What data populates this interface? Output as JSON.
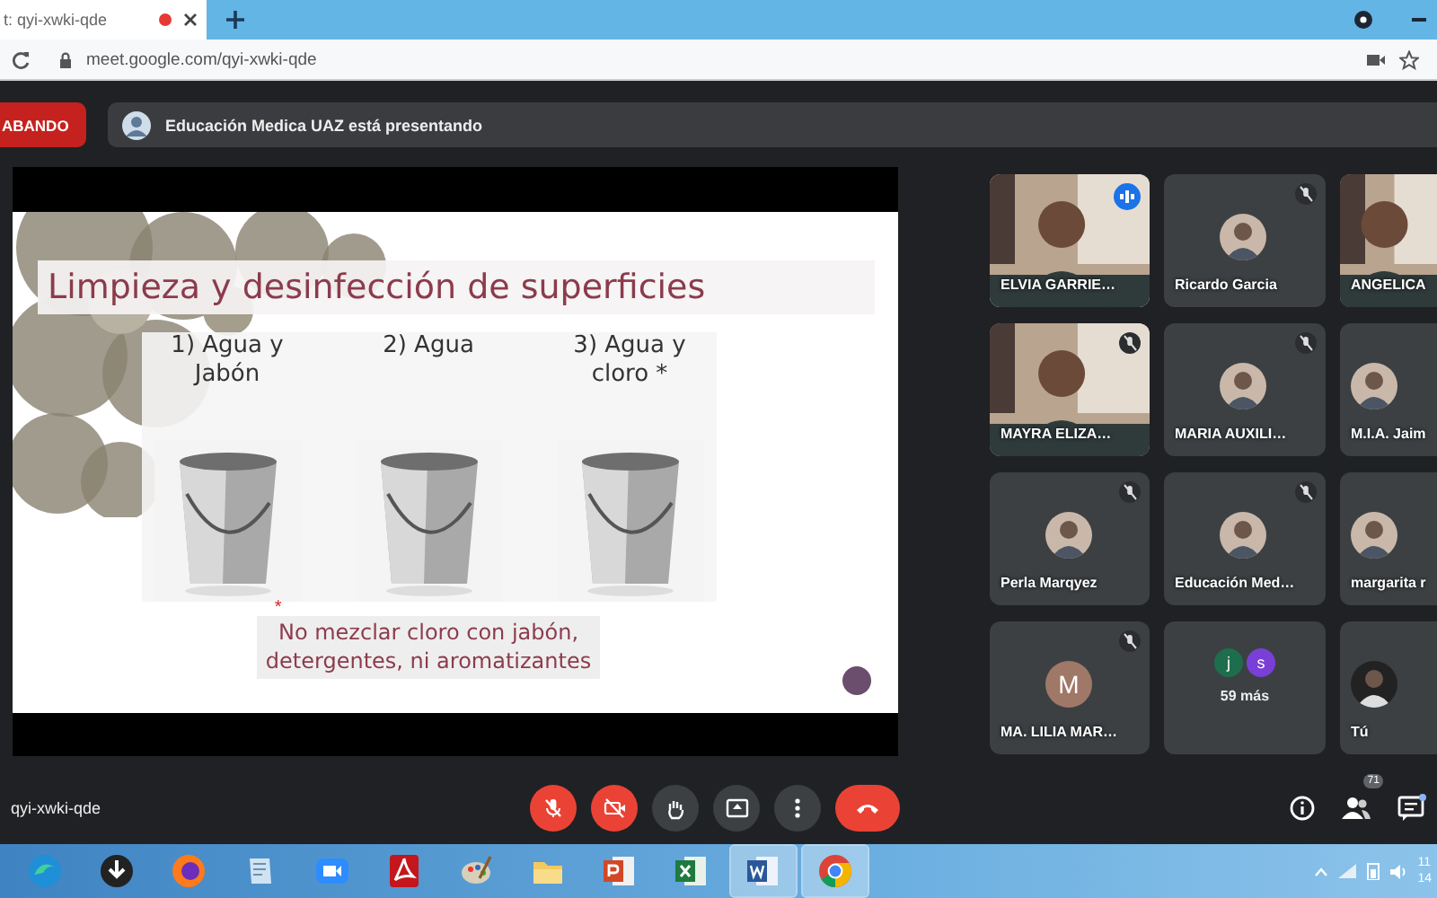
{
  "browser": {
    "tab_title": "t: qyi-xwki-qde",
    "url": "meet.google.com/qyi-xwki-qde"
  },
  "recording": {
    "label": "ABANDO"
  },
  "presenter_banner": {
    "text": "Educación Medica UAZ está presentando"
  },
  "slide": {
    "title": "Limpieza y desinfección de superficies",
    "options": [
      {
        "label": "1) Agua y\nJabón"
      },
      {
        "label": "2) Agua"
      },
      {
        "label": "3) Agua y\ncloro *"
      }
    ],
    "footnote_mark": "*",
    "note": "No mezclar cloro con jabón,\ndetergentes, ni aromatizantes"
  },
  "participants": [
    {
      "kind": "video",
      "name": "ELVIA GARRIE…",
      "muted": false,
      "speaking": true
    },
    {
      "kind": "avatar",
      "name": "Ricardo Garcia",
      "muted": true,
      "speaking": false
    },
    {
      "kind": "video",
      "name": "ANGELICA",
      "muted": false,
      "speaking": false
    },
    {
      "kind": "video",
      "name": "MAYRA ELIZA…",
      "muted": true,
      "speaking": false
    },
    {
      "kind": "avatar",
      "name": "MARIA AUXILI…",
      "muted": true,
      "speaking": false
    },
    {
      "kind": "avatar",
      "name": "M.I.A. Jaim",
      "muted": false,
      "speaking": false
    },
    {
      "kind": "avatar",
      "name": "Perla Marqyez",
      "muted": true,
      "speaking": false
    },
    {
      "kind": "avatar",
      "name": "Educación Med…",
      "muted": true,
      "speaking": false
    },
    {
      "kind": "avatar",
      "name": "margarita r",
      "muted": false,
      "speaking": false
    },
    {
      "kind": "letter",
      "name": "MA. LILIA MAR…",
      "initial": "M",
      "color": "#a07868",
      "muted": true,
      "speaking": false
    },
    {
      "kind": "more",
      "name": "59 más",
      "initials": [
        {
          "letter": "j",
          "color": "#1e6e4e"
        },
        {
          "letter": "s",
          "color": "#7a3fd6"
        }
      ],
      "muted": false,
      "speaking": false
    },
    {
      "kind": "self",
      "name": "Tú",
      "muted": false,
      "speaking": false
    }
  ],
  "meeting_code": "qyi-xwki-qde",
  "controls": {
    "mic_on": false,
    "camera_on": false
  },
  "people_count": "71",
  "taskbar": {
    "apps": [
      {
        "kind": "edge",
        "active": false
      },
      {
        "kind": "download",
        "active": false
      },
      {
        "kind": "firefox",
        "active": false
      },
      {
        "kind": "notes",
        "active": false
      },
      {
        "kind": "zoom",
        "active": false
      },
      {
        "kind": "pdf",
        "active": false
      },
      {
        "kind": "paint",
        "active": false
      },
      {
        "kind": "folder",
        "active": false
      },
      {
        "kind": "powerpoint",
        "active": false
      },
      {
        "kind": "excel",
        "active": false
      },
      {
        "kind": "word",
        "active": true
      },
      {
        "kind": "chrome",
        "active": true
      }
    ],
    "clock": [
      "11",
      "14"
    ]
  }
}
